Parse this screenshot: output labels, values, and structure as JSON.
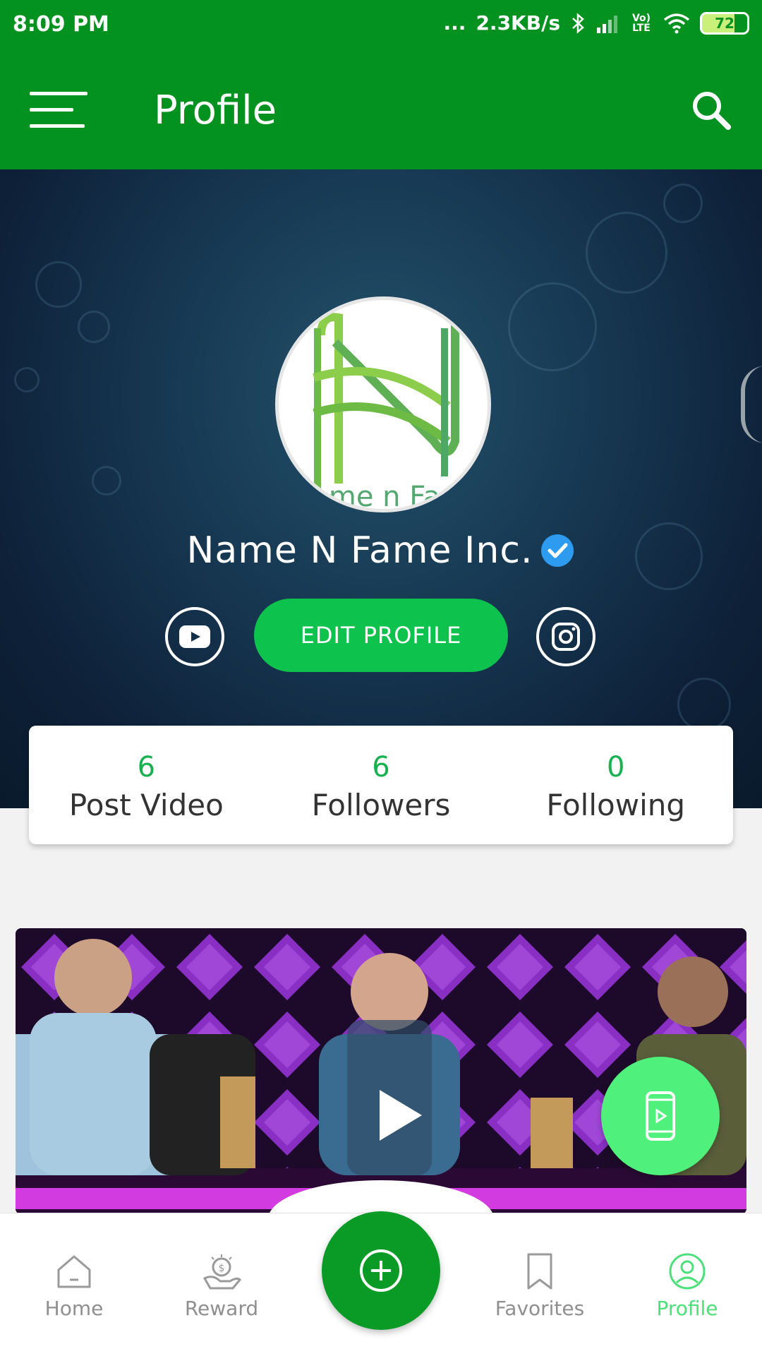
{
  "status_bar": {
    "time": "8:09 PM",
    "dots": "...",
    "net_speed": "2.3KB/s",
    "volte": "Vo) LTE",
    "battery": "72"
  },
  "app_bar": {
    "title": "Profile",
    "menu_icon": "hamburger-menu",
    "search_icon": "search"
  },
  "profile": {
    "name": "Name N Fame Inc.",
    "verified": true,
    "logo_text": "me n Fa",
    "edit_button": "EDIT PROFILE",
    "social": [
      "youtube",
      "instagram"
    ]
  },
  "stats": [
    {
      "value": "6",
      "label": "Post Video"
    },
    {
      "value": "6",
      "label": "Followers"
    },
    {
      "value": "0",
      "label": "Following"
    }
  ],
  "bottom_nav": [
    {
      "label": "Home",
      "icon": "home"
    },
    {
      "label": "Reward",
      "icon": "reward"
    },
    {
      "label": "Favorites",
      "icon": "bookmark"
    },
    {
      "label": "Profile",
      "icon": "user",
      "active": true
    }
  ],
  "colors": {
    "primary": "#03921f",
    "accent": "#0ec24e",
    "active_nav": "#4ce07a",
    "fab_video": "#4ff07b"
  }
}
